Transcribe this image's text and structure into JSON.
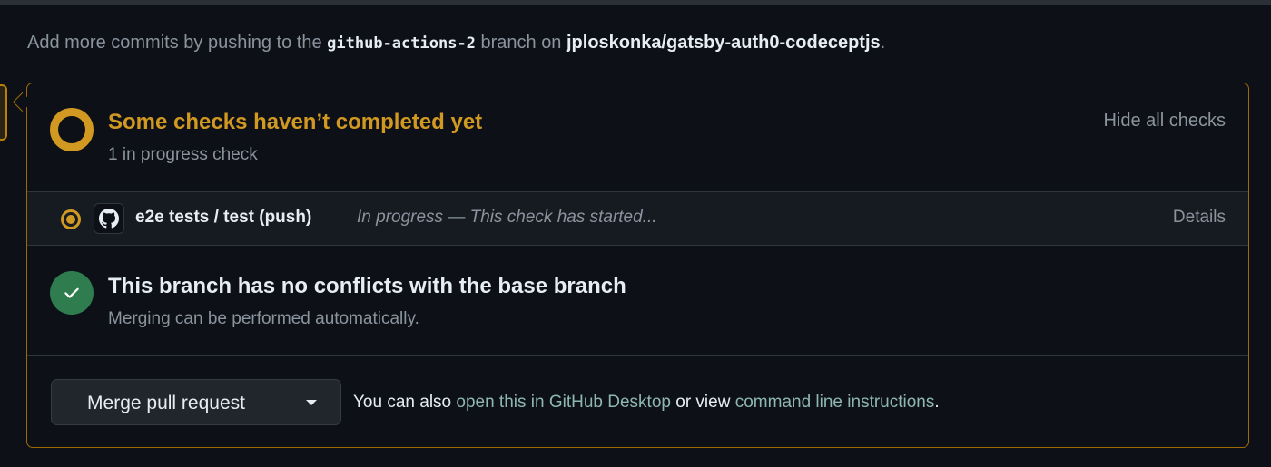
{
  "intro": {
    "prefix": "Add more commits by pushing to the ",
    "branch": "github-actions-2",
    "middle": " branch on ",
    "repo": "jploskonka/gatsby-auth0-codeceptjs",
    "suffix": "."
  },
  "checks": {
    "title": "Some checks haven’t completed yet",
    "subtitle": "1 in progress check",
    "hide_label": "Hide all checks",
    "status_color": "#d29922",
    "items": [
      {
        "icon": "github-icon",
        "name": "e2e tests / test (push)",
        "status": "In progress — This check has started...",
        "details_label": "Details"
      }
    ]
  },
  "conflicts": {
    "icon": "check-icon",
    "title": "This branch has no conflicts with the base branch",
    "subtitle": "Merging can be performed automatically.",
    "status_color": "#2f7d4f"
  },
  "merge": {
    "button_label": "Merge pull request",
    "dropdown_icon": "caret-down-icon",
    "also_prefix": "You can also ",
    "desktop_link": "open this in GitHub Desktop",
    "also_middle": " or view ",
    "cli_link": "command line instructions",
    "also_suffix": "."
  }
}
